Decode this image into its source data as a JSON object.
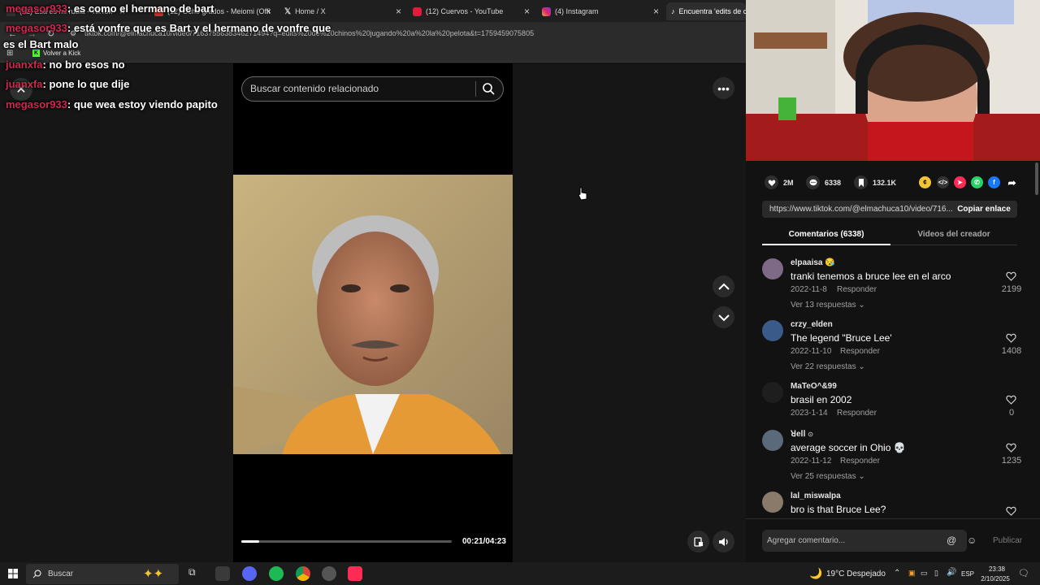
{
  "browser": {
    "tabs": [
      {
        "label": "(12) Esa es mi rubia - TikTok"
      },
      {
        "label": "(12) Ocho grados - Meiomi (Offi"
      },
      {
        "label": "Home / X"
      },
      {
        "label": "(12) Cuervos - YouTube"
      },
      {
        "label": "(4) Instagram"
      },
      {
        "label": "Encuentra 'edits de ch"
      }
    ],
    "url": "tiktok.com/@elmachuca10/video/7163755638346271494?q=edits%20de%20chinos%20jugando%20a%20la%20pelota&t=1759459075805",
    "bookmark": "Volver a Kick"
  },
  "chat": [
    {
      "user": "megasor933",
      "msg": ": es como el hermano de bart"
    },
    {
      "user": "megasor933",
      "msg": ": está vonfre que es Bart y el hermano de vonfre que"
    },
    {
      "user": "",
      "msg": "es el Bart malo"
    },
    {
      "user": "juanxfa",
      "msg": ": no bro esos no"
    },
    {
      "user": "juanxfa",
      "msg": ": pone lo que dije"
    },
    {
      "user": "megasor933",
      "msg": ": que wea estoy viendo papito"
    }
  ],
  "search": {
    "placeholder": "Buscar contenido relacionado"
  },
  "player": {
    "time": "00:21/04:23",
    "progress": 0.086
  },
  "stats": {
    "likes": "2M",
    "comments": "6338",
    "saves": "132.1K"
  },
  "link": {
    "url": "https://www.tiktok.com/@elmachuca10/video/716...",
    "copy": "Copiar enlace"
  },
  "tabs": {
    "comments": "Comentarios (6338)",
    "videos": "Videos del creador"
  },
  "comments": [
    {
      "user": "elpaaisa",
      "text": "tranki tenemos a bruce lee en el arco",
      "date": "2022-11-8",
      "reply": "Responder",
      "likes": "2199",
      "more": "Ver 13 respuestas"
    },
    {
      "user": "crzy_elden",
      "text": "The legend \"Bruce Lee'",
      "date": "2022-11-10",
      "reply": "Responder",
      "likes": "1408",
      "more": "Ver 22 respuestas"
    },
    {
      "user": "MaTeO^&99",
      "text": "brasil en 2002",
      "date": "2023-1-14",
      "reply": "Responder",
      "likes": "0",
      "more": ""
    },
    {
      "user": "ꓤeꓲꓲ",
      "text": "average soccer in Ohio 💀",
      "date": "2022-11-12",
      "reply": "Responder",
      "likes": "1235",
      "more": "Ver 25 respuestas"
    },
    {
      "user": "lal_miswalpa",
      "text": "bro is that Bruce Lee?",
      "date": "",
      "reply": "",
      "likes": "",
      "more": ""
    }
  ],
  "composer": {
    "placeholder": "Agregar comentario...",
    "publish": "Publicar"
  },
  "taskbar": {
    "search": "Buscar",
    "weather": "19°C  Despejado",
    "lang": "ESP",
    "time": "23:38",
    "date": "2/10/2025"
  },
  "colors": {
    "accent": "#fe2c55",
    "chat_user": "#d0274f"
  }
}
